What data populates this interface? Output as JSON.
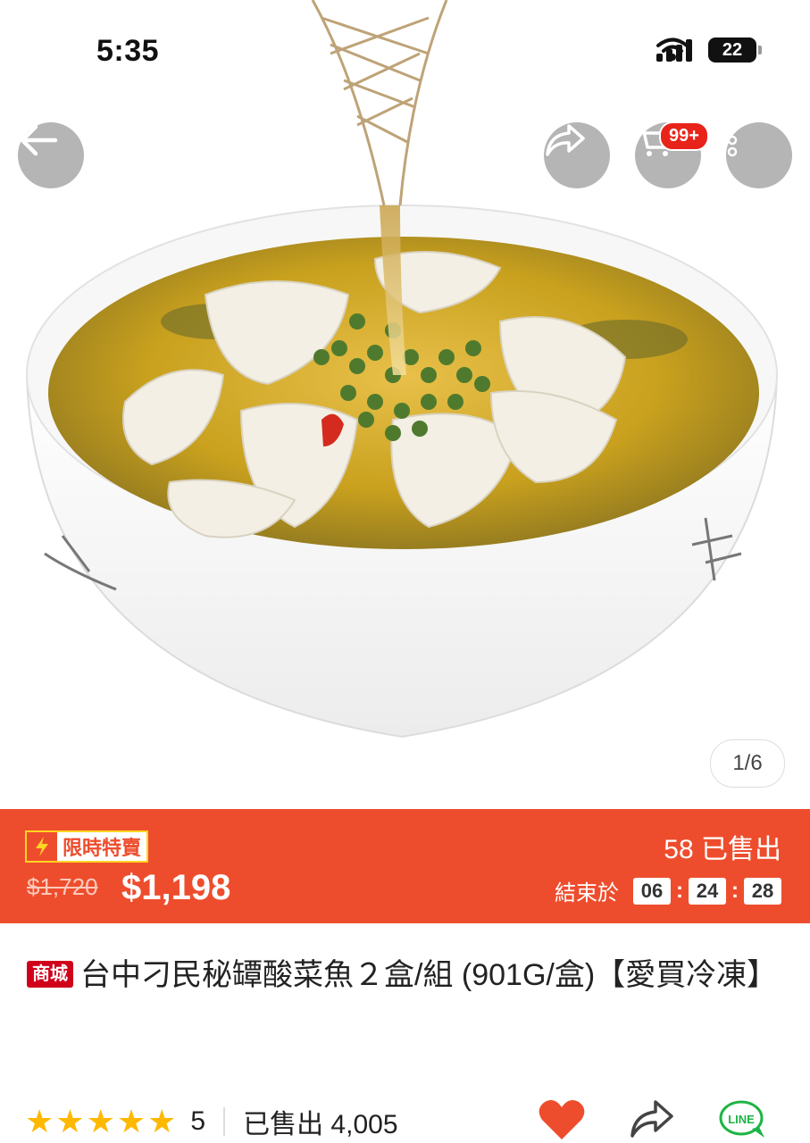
{
  "status_bar": {
    "time": "5:35",
    "battery": "22"
  },
  "nav": {
    "cart_badge": "99+"
  },
  "gallery": {
    "pager": "1/6"
  },
  "flash_sale": {
    "tag_label": "限時特賣",
    "original_price": "$1,720",
    "sale_price": "$1,198",
    "sold": "58 已售出",
    "ends_label": "結束於",
    "hours": "06",
    "minutes": "24",
    "seconds": "28",
    "colors": {
      "bar": "#ee4d2d",
      "tag_border": "#ffd424"
    }
  },
  "product": {
    "mall_badge": "商城",
    "title": "台中刁民秘罈酸菜魚２盒/組 (901G/盒)【愛買冷凍】"
  },
  "rating": {
    "score": "5",
    "stars": 5,
    "sold_total": "已售出 4,005"
  },
  "icons": [
    "back-arrow-icon",
    "share-icon",
    "cart-icon",
    "more-icon",
    "lightning-icon",
    "star-icon",
    "heart-icon",
    "line-icon"
  ]
}
